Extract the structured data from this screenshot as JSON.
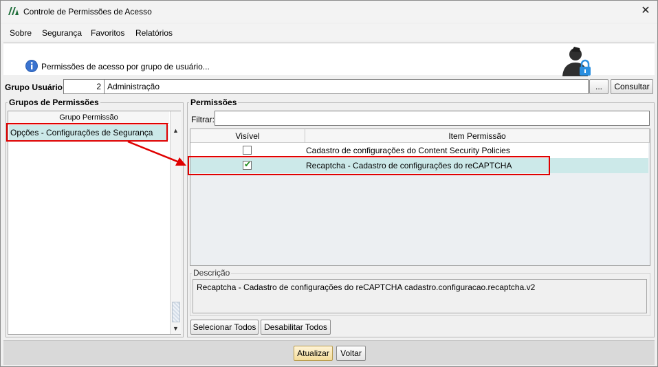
{
  "window": {
    "title": "Controle de Permissões de Acesso",
    "close_glyph": "✕"
  },
  "menu": [
    {
      "label": "Sobre"
    },
    {
      "label": "Segurança"
    },
    {
      "label": "Favoritos"
    },
    {
      "label": "Relatórios"
    }
  ],
  "header": {
    "text": "Permissões de acesso por grupo de usuário...",
    "icons": [
      "info-icon",
      "user-lock-icon"
    ]
  },
  "grupo_usuario": {
    "label": "Grupo Usuário:",
    "code": "2",
    "name": "Administração",
    "browse_label": "...",
    "consultar_label": "Consultar"
  },
  "grupos_permissoes": {
    "legend": "Grupos de Permissões",
    "column": "Grupo Permissão",
    "items": [
      "Opções - Configurações de Segurança"
    ]
  },
  "permissoes": {
    "legend": "Permissões",
    "filter_label": "Filtrar:",
    "filter_value": "",
    "columns": [
      "Visível",
      "Item Permissão"
    ],
    "rows": [
      {
        "visible": false,
        "item": "Cadastro de configurações do Content Security Policies"
      },
      {
        "visible": true,
        "item": "Recaptcha - Cadastro de configurações do reCAPTCHA"
      }
    ],
    "descricao_legend": "Descrição",
    "descricao": "Recaptcha - Cadastro de configurações do reCAPTCHA cadastro.configuracao.recaptcha.v2",
    "select_all_label": "Selecionar Todos",
    "disable_all_label": "Desabilitar Todos"
  },
  "footer": {
    "atualizar_label": "Atualizar",
    "voltar_label": "Voltar"
  },
  "colors": {
    "selection": "#cce9e9",
    "annotation": "#e00000"
  }
}
